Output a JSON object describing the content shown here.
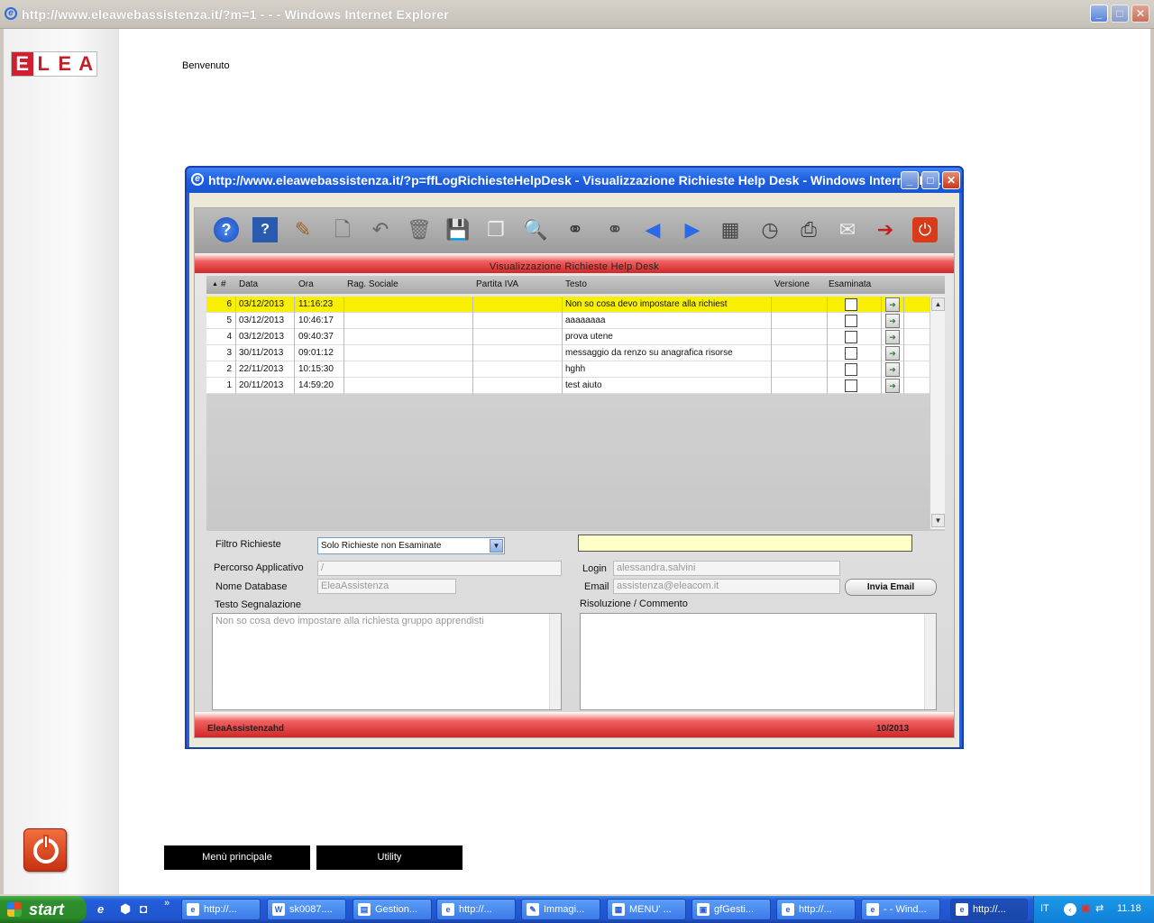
{
  "ie": {
    "title": "http://www.eleawebassistenza.it/?m=1 - - - Windows Internet Explorer"
  },
  "page": {
    "logo_letters": [
      "E",
      "L",
      "E",
      "A"
    ],
    "welcome": "Benvenuto",
    "bottom_buttons": [
      "Menù principale",
      "Utility"
    ]
  },
  "popup": {
    "title": "http://www.eleawebassistenza.it/?p=ffLogRichiesteHelpDesk - Visualizzazione Richieste Help Desk - Windows Internet Ex...",
    "toolbar_icons": [
      "help-icon",
      "question-icon",
      "edit-icon",
      "new-document-icon",
      "undo-icon",
      "trash-icon",
      "save-icon",
      "copy-icon",
      "search-icon",
      "binoculars-icon",
      "advanced-search-icon",
      "previous-icon",
      "next-icon",
      "calendar-icon",
      "clock-icon",
      "print-icon",
      "email-icon",
      "exit-icon",
      "power-icon"
    ],
    "header": "Visualizzazione Richieste Help Desk",
    "columns": {
      "num": "#",
      "data": "Data",
      "ora": "Ora",
      "rag": "Rag. Sociale",
      "piva": "Partita IVA",
      "testo": "Testo",
      "versione": "Versione",
      "esaminata": "Esaminata"
    },
    "sort_indicator": "▲",
    "rows": [
      {
        "n": "6",
        "data": "03/12/2013",
        "ora": "11:16:23",
        "rag": "",
        "piva": "",
        "testo": "Non so cosa devo impostare alla richiest",
        "versione": "",
        "selected": true
      },
      {
        "n": "5",
        "data": "03/12/2013",
        "ora": "10:46:17",
        "rag": "",
        "piva": "",
        "testo": "aaaaaaaa",
        "versione": "",
        "selected": false
      },
      {
        "n": "4",
        "data": "03/12/2013",
        "ora": "09:40:37",
        "rag": "",
        "piva": "",
        "testo": "prova utene",
        "versione": "",
        "selected": false
      },
      {
        "n": "3",
        "data": "30/11/2013",
        "ora": "09:01:12",
        "rag": "",
        "piva": "",
        "testo": "messaggio da renzo su anagrafica risorse",
        "versione": "",
        "selected": false
      },
      {
        "n": "2",
        "data": "22/11/2013",
        "ora": "10:15:30",
        "rag": "",
        "piva": "",
        "testo": "hghh",
        "versione": "",
        "selected": false
      },
      {
        "n": "1",
        "data": "20/11/2013",
        "ora": "14:59:20",
        "rag": "",
        "piva": "",
        "testo": "test aiuto",
        "versione": "",
        "selected": false
      }
    ],
    "form": {
      "filtro_label": "Filtro Richieste",
      "filtro_value": "Solo Richieste non Esaminate",
      "percorso_label": "Percorso Applicativo",
      "percorso_value": "/",
      "nome_db_label": "Nome Database",
      "nome_db_value": "EleaAssistenza",
      "login_label": "Login",
      "login_value": "alessandra.salvini",
      "email_label": "Email",
      "email_value": "assistenza@eleacom.it",
      "invia_email": "Invia Email",
      "testo_label": "Testo Segnalazione",
      "testo_value": "Non so cosa devo impostare alla richiesta gruppo apprendisti",
      "risoluzione_label": "Risoluzione / Commento",
      "risoluzione_value": ""
    },
    "footer": {
      "left": "EleaAssistenzahd",
      "right": "10/2013"
    }
  },
  "taskbar": {
    "start": "start",
    "tasks": [
      "http://...",
      "sk0087....",
      "Gestion...",
      "http://...",
      "Immagi...",
      "MENU' ...",
      "gfGesti...",
      "http://...",
      "- - Wind...",
      "http://..."
    ],
    "lang": "IT",
    "time": "11.18"
  },
  "colors": {
    "title_blue": "#2a5fd8",
    "accent_red": "#d02828",
    "selected_row": "#f8f000",
    "highlight_input": "#ffffc8"
  }
}
